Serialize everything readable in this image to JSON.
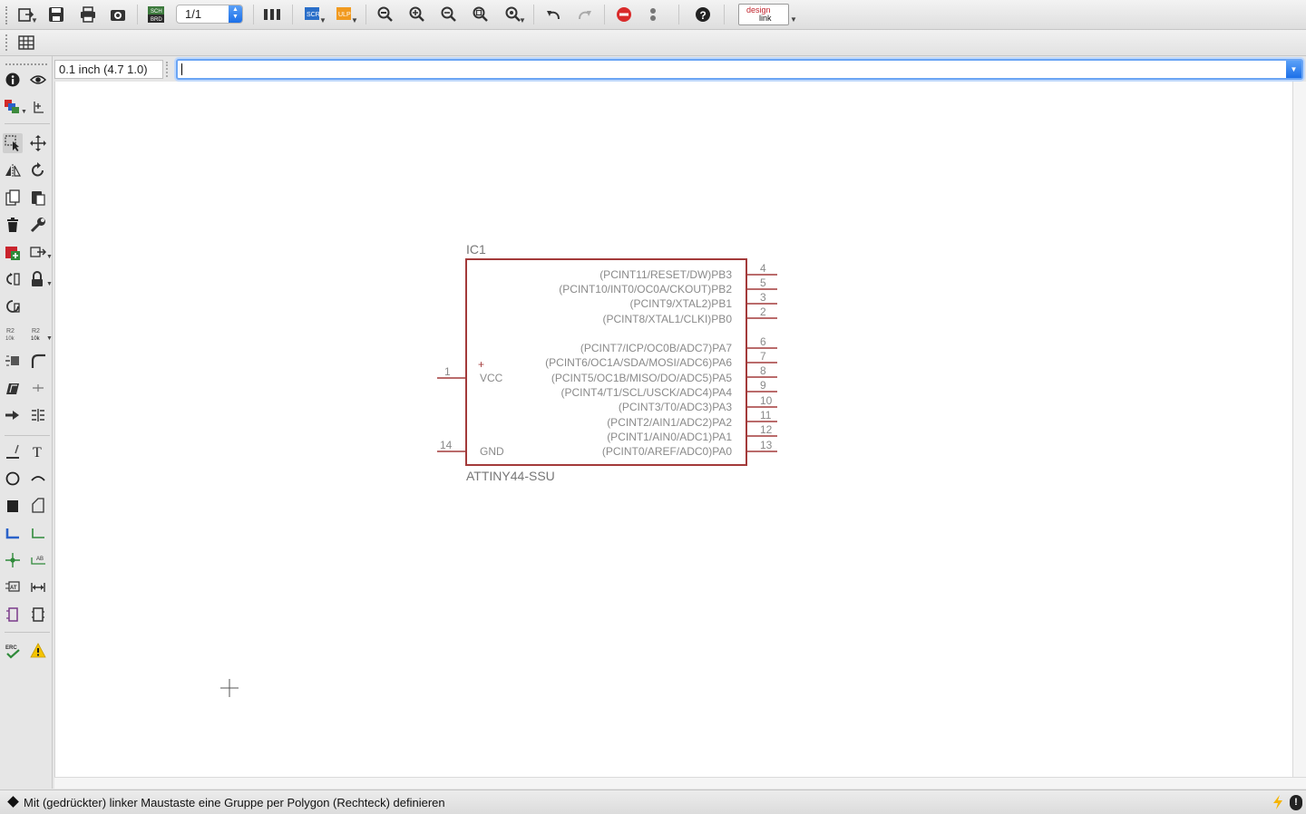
{
  "toolbar": {
    "sheet_value": "1/1",
    "design_link_line1": "design",
    "design_link_line2": "link"
  },
  "command_bar": {
    "grid_size": "0.1 inch (4.7 1.0)",
    "command_value": ""
  },
  "schematic": {
    "part_name": "IC1",
    "part_value": "ATTINY44-SSU",
    "power_pins": [
      {
        "number": "1",
        "name": "VCC",
        "plus": "+"
      },
      {
        "number": "14",
        "name": "GND"
      }
    ],
    "right_pins": [
      {
        "number": "4",
        "name": "(PCINT11/RESET/DW)PB3"
      },
      {
        "number": "5",
        "name": "(PCINT10/INT0/OC0A/CKOUT)PB2"
      },
      {
        "number": "3",
        "name": "(PCINT9/XTAL2)PB1"
      },
      {
        "number": "2",
        "name": "(PCINT8/XTAL1/CLKI)PB0"
      },
      {
        "number": "6",
        "name": "(PCINT7/ICP/OC0B/ADC7)PA7"
      },
      {
        "number": "7",
        "name": "(PCINT6/OC1A/SDA/MOSI/ADC6)PA6"
      },
      {
        "number": "8",
        "name": "(PCINT5/OC1B/MISO/DO/ADC5)PA5"
      },
      {
        "number": "9",
        "name": "(PCINT4/T1/SCL/USCK/ADC4)PA4"
      },
      {
        "number": "10",
        "name": "(PCINT3/T0/ADC3)PA3"
      },
      {
        "number": "11",
        "name": "(PCINT2/AIN1/ADC2)PA2"
      },
      {
        "number": "12",
        "name": "(PCINT1/AIN0/ADC1)PA1"
      },
      {
        "number": "13",
        "name": "(PCINT0/AREF/ADC0)PA0"
      }
    ]
  },
  "status": {
    "message": "Mit (gedrückter) linker Maustaste eine Gruppe per Polygon (Rechteck) definieren",
    "error_indicator": "!"
  },
  "colors": {
    "symbol": "#a33a3a",
    "pin_text": "#8a8a8a",
    "label_text": "#7a7a7a"
  }
}
